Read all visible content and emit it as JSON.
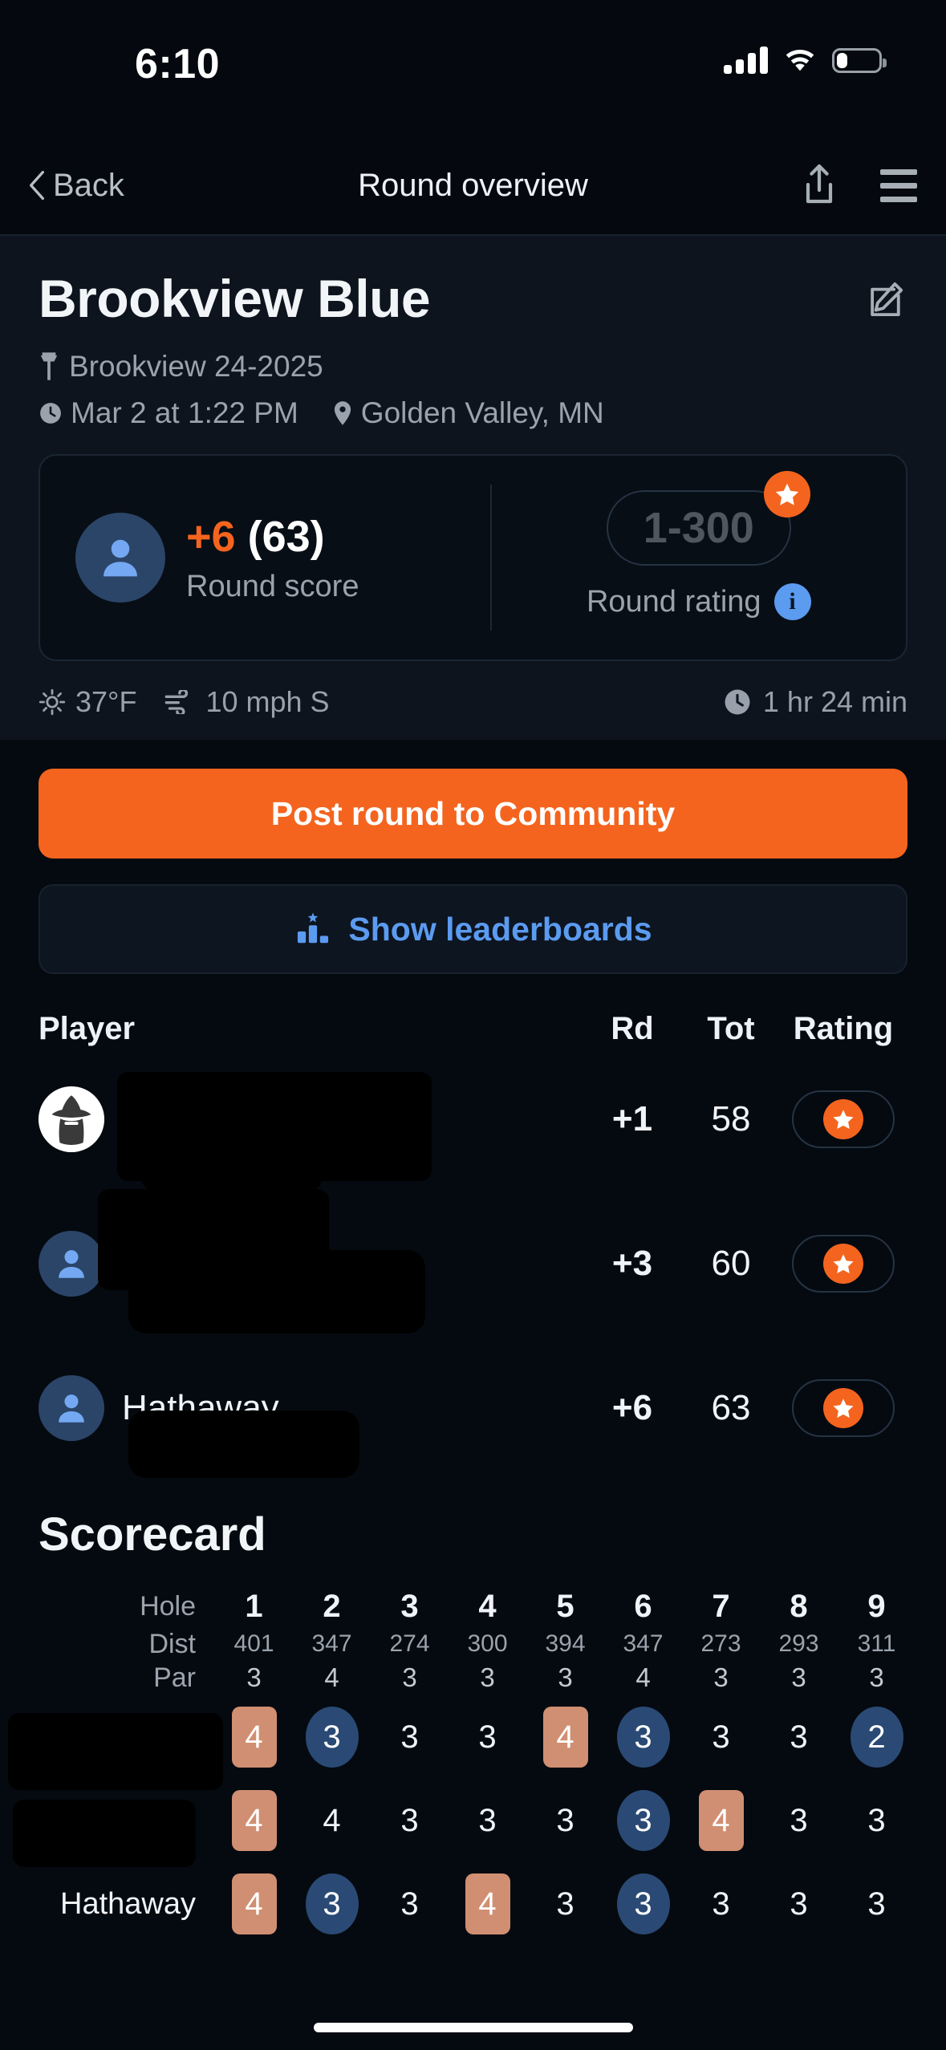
{
  "status_bar": {
    "time": "6:10",
    "cellular_icon": "cellular-signal-icon",
    "wifi_icon": "wifi-icon",
    "battery_icon": "battery-low-icon"
  },
  "nav": {
    "back_label": "Back",
    "title": "Round overview",
    "share_icon": "share-icon",
    "menu_icon": "hamburger-menu-icon"
  },
  "round": {
    "title": "Brookview Blue",
    "edit_icon": "edit-pencil-icon",
    "layout_icon": "basket-pin-icon",
    "layout": "Brookview 24-2025",
    "time_icon": "clock-icon",
    "datetime": "Mar 2 at 1:22 PM",
    "location_icon": "map-pin-icon",
    "location": "Golden Valley, MN"
  },
  "score_box": {
    "avatar_icon": "person-avatar-icon",
    "relative_score": "+6",
    "total_score": "(63)",
    "score_label": "Round score",
    "rating_value": "1-300",
    "rating_label": "Round rating",
    "star_icon": "star-icon",
    "info_icon": "info-icon",
    "info_glyph": "i"
  },
  "conditions": {
    "temp_icon": "sun-icon",
    "temperature": "37°F",
    "wind_icon": "wind-icon",
    "wind": "10 mph S",
    "duration_icon": "clock-icon",
    "duration": "1 hr 24 min"
  },
  "actions": {
    "post_label": "Post round to Community",
    "leaderboards_icon": "podium-star-icon",
    "leaderboards_label": "Show leaderboards"
  },
  "players_table": {
    "headers": {
      "player": "Player",
      "rd": "Rd",
      "tot": "Tot",
      "rating": "Rating"
    },
    "rows": [
      {
        "avatar_icon": "wizard-avatar-icon",
        "name": "",
        "name_redacted": true,
        "rd": "+1",
        "tot": "58",
        "rating_icon": "star-icon"
      },
      {
        "avatar_icon": "person-avatar-icon",
        "name": "",
        "name_redacted": true,
        "rd": "+3",
        "tot": "60",
        "rating_icon": "star-icon"
      },
      {
        "avatar_icon": "person-avatar-icon",
        "name": "Hathaway",
        "name_redacted": false,
        "rd": "+6",
        "tot": "63",
        "rating_icon": "star-icon"
      }
    ]
  },
  "scorecard": {
    "title": "Scorecard",
    "labels": {
      "hole": "Hole",
      "dist": "Dist",
      "par": "Par"
    },
    "holes": [
      "1",
      "2",
      "3",
      "4",
      "5",
      "6",
      "7",
      "8",
      "9"
    ],
    "dist": [
      "401",
      "347",
      "274",
      "300",
      "394",
      "347",
      "273",
      "293",
      "311"
    ],
    "par": [
      "3",
      "4",
      "3",
      "3",
      "3",
      "4",
      "3",
      "3",
      "3"
    ],
    "player_rows": [
      {
        "name": "",
        "name_redacted": true,
        "scores": [
          "4",
          "3",
          "3",
          "3",
          "4",
          "3",
          "3",
          "3",
          "2"
        ],
        "marks": [
          "bogey",
          "birdie",
          "par",
          "par",
          "bogey",
          "birdie",
          "par",
          "par",
          "birdie"
        ]
      },
      {
        "name": "",
        "name_redacted": true,
        "scores": [
          "4",
          "4",
          "3",
          "3",
          "3",
          "3",
          "4",
          "3",
          "3"
        ],
        "marks": [
          "bogey",
          "par",
          "par",
          "par",
          "par",
          "birdie",
          "bogey",
          "par",
          "par"
        ]
      },
      {
        "name": "Hathaway",
        "name_redacted": false,
        "scores": [
          "4",
          "3",
          "3",
          "4",
          "3",
          "3",
          "3",
          "3",
          "3"
        ],
        "marks": [
          "bogey",
          "birdie",
          "par",
          "bogey",
          "par",
          "birdie",
          "par",
          "par",
          "par"
        ]
      }
    ]
  },
  "colors": {
    "accent_orange": "#f4641e",
    "accent_blue": "#5b9bf0",
    "bogey": "#d08f72",
    "birdie": "#2a4a75",
    "panel": "#0d141d",
    "background": "#050a10"
  }
}
